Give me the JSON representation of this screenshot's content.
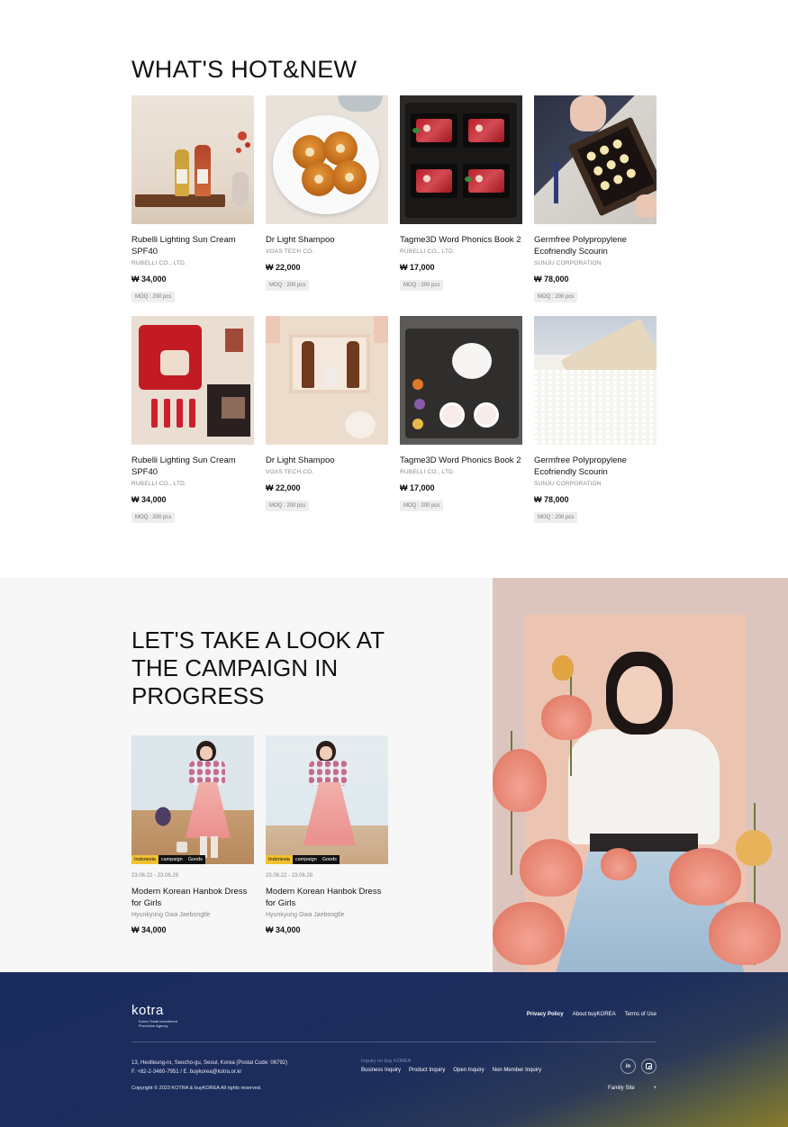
{
  "hot_new": {
    "title": "WHAT'S HOT&NEW",
    "products": [
      {
        "name": "Rubelli Lighting Sun Cream SPF40",
        "company": "RUBELLI CO., LTD.",
        "price": "₩ 34,000",
        "moq": "MOQ : 200 pcs",
        "image": "liquor-bottles-image"
      },
      {
        "name": "Dr Light Shampoo",
        "company": "VOAS TECH CO.",
        "price": "₩ 22,000",
        "moq": "MOQ : 200 pcs",
        "image": "yakgwa-cookies-image"
      },
      {
        "name": "Tagme3D Word Phonics Book 2",
        "company": "RUBELLI CO., LTD.",
        "price": "₩ 17,000",
        "moq": "MOQ : 200 pcs",
        "image": "hanwoo-beef-box-image"
      },
      {
        "name": "Germfree Polypropylene Ecofriendly Scourin",
        "company": "SUNJU CORPORATION",
        "price": "₩ 78,000",
        "moq": "MOQ : 200 pcs",
        "image": "gift-tray-image"
      },
      {
        "name": "Rubelli Lighting Sun Cream SPF40",
        "company": "RUBELLI CO., LTD.",
        "price": "₩ 34,000",
        "moq": "MOQ : 200 pcs",
        "image": "bojagi-gift-set-image"
      },
      {
        "name": "Dr Light Shampoo",
        "company": "VOAS TECH CO.",
        "price": "₩ 22,000",
        "moq": "MOQ : 200 pcs",
        "image": "bottle-gift-box-image"
      },
      {
        "name": "Tagme3D Word Phonics Book 2",
        "company": "RUBELLI CO., LTD.",
        "price": "₩ 17,000",
        "moq": "MOQ : 200 pcs",
        "image": "tea-set-image"
      },
      {
        "name": "Germfree Polypropylene Ecofriendly Scourin",
        "company": "SUNJU CORPORATION",
        "price": "₩ 78,000",
        "moq": "MOQ : 200 pcs",
        "image": "rice-box-image"
      }
    ]
  },
  "campaign": {
    "title": "LET'S TAKE A LOOK AT THE CAMPAIGN IN PROGRESS",
    "items": [
      {
        "tags": [
          "Indonesia",
          "campaign",
          "Goods"
        ],
        "date": "23.06.22 - 23.06.28",
        "name": "Modern Korean Hanbok Dress for Girls",
        "company": "Hyunkyung Gwa Jaebongtle",
        "price": "₩ 34,000"
      },
      {
        "tags": [
          "Indonesia",
          "campaign",
          "Goods"
        ],
        "date": "23.06.22 - 23.06.28",
        "name": "Modern Korean Hanbok Dress for Girls",
        "company": "Hyunkyung Gwa Jaebongtle",
        "price": "₩ 34,000"
      }
    ],
    "hero_image": "hanbok-woman-flowers-image"
  },
  "footer": {
    "logo": "kotra",
    "logo_sub": "Korea Trade-Investment Promotion Agency",
    "links": {
      "privacy": "Privacy Policy",
      "about": "About buyKOREA",
      "terms": "Terms of Use"
    },
    "address": "13, Heolleung-ro, Seocho-gu, Seoul, Korea (Postal Code: 06792)",
    "contact": "F. +82-2-3460-7951 / E. buykorea@kotra.or.kr",
    "copyright": "Copyright © 2023 KOTRA & buyKOREA All rights reserved.",
    "inquiry": {
      "label": "Inquiry on buy KOREA",
      "items": [
        "Business Inquiry",
        "Product Inquiry",
        "Open Inquiry",
        "Non Member Inquiry"
      ]
    },
    "social": {
      "linkedin": "in",
      "instagram": "instagram-icon"
    },
    "family_site": {
      "label": "Family Site",
      "symbol": "+"
    }
  },
  "colors": {
    "footer_bg": "#1a2b5e",
    "tag_yellow": "#f2c12e",
    "accent_gold": "#8a7a2a"
  }
}
